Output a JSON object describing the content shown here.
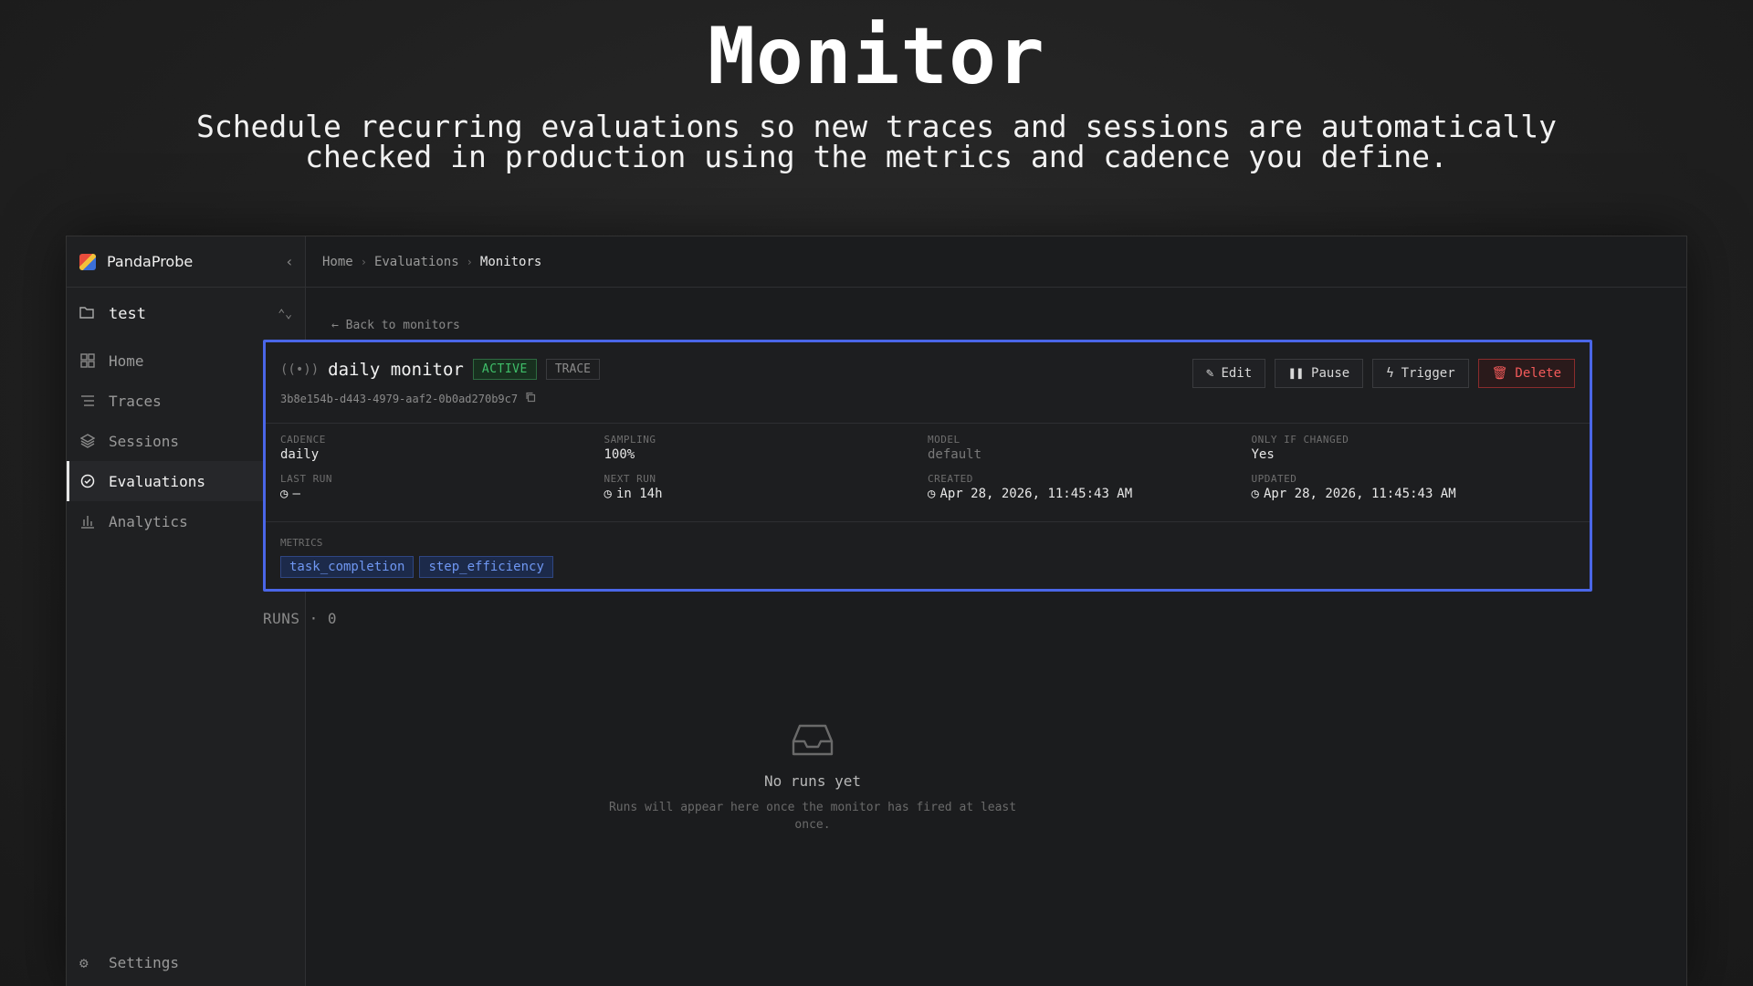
{
  "hero": {
    "title": "Monitor",
    "subtitle_line1": "Schedule recurring evaluations so new traces and sessions are automatically",
    "subtitle_line2": "checked in production using the metrics and cadence you define."
  },
  "sidebar": {
    "brand": "PandaProbe",
    "project": "test",
    "items": [
      {
        "label": "Home",
        "icon": "grid-icon"
      },
      {
        "label": "Traces",
        "icon": "list-icon"
      },
      {
        "label": "Sessions",
        "icon": "layers-icon"
      },
      {
        "label": "Evaluations",
        "icon": "check-circle-icon",
        "active": true
      },
      {
        "label": "Analytics",
        "icon": "bar-chart-icon"
      }
    ],
    "settings": "Settings"
  },
  "breadcrumb": {
    "items": [
      "Home",
      "Evaluations"
    ],
    "current": "Monitors"
  },
  "back_link": "← Back to monitors",
  "monitor": {
    "name": "daily monitor",
    "status": "ACTIVE",
    "type": "TRACE",
    "id": "3b8e154b-d443-4979-aaf2-0b0ad270b9c7",
    "actions": {
      "edit": "Edit",
      "pause": "Pause",
      "trigger": "Trigger",
      "delete": "Delete"
    },
    "fields": {
      "cadence": {
        "label": "CADENCE",
        "value": "daily"
      },
      "sampling": {
        "label": "SAMPLING",
        "value": "100%"
      },
      "model": {
        "label": "MODEL",
        "value": "default"
      },
      "only_if_changed": {
        "label": "ONLY IF CHANGED",
        "value": "Yes"
      },
      "last_run": {
        "label": "LAST RUN",
        "value": "—"
      },
      "next_run": {
        "label": "NEXT RUN",
        "value": "in 14h"
      },
      "created": {
        "label": "CREATED",
        "value": "Apr 28, 2026, 11:45:43 AM"
      },
      "updated": {
        "label": "UPDATED",
        "value": "Apr 28, 2026, 11:45:43 AM"
      }
    },
    "metrics_label": "METRICS",
    "metrics": [
      "task_completion",
      "step_efficiency"
    ]
  },
  "runs": {
    "label": "RUNS · 0",
    "empty_title": "No runs yet",
    "empty_desc": "Runs will appear here once the monitor has fired at least once."
  },
  "colors": {
    "accent_border": "#4a66e8",
    "active_green": "#3fbf6a",
    "danger_red": "#f25a5a",
    "metric_blue": "#6f97f2"
  }
}
